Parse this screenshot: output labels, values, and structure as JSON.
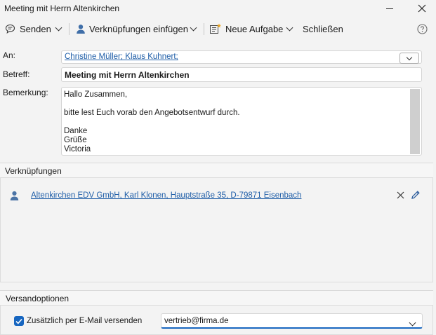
{
  "window": {
    "title": "Meeting mit Herrn Altenkirchen",
    "minimize_icon": "minimize-icon",
    "close_icon": "close-icon"
  },
  "toolbar": {
    "send_label": "Senden",
    "links_insert_label": "Verknüpfungen einfügen",
    "new_task_label": "Neue Aufgabe",
    "close_label": "Schließen",
    "help_icon": "help-icon"
  },
  "form": {
    "to_label": "An:",
    "to_value": "Christine Müller; Klaus Kuhnert;",
    "subject_label": "Betreff:",
    "subject_value": "Meeting mit Herrn Altenkirchen",
    "remark_label": "Bemerkung:",
    "remark_lines": [
      "Hallo Zusammen,",
      "",
      "bitte lest Euch vorab den Angebotsentwurf durch.",
      "",
      "Danke",
      "Grüße",
      "Victoria"
    ]
  },
  "links_section": {
    "header": "Verknüpfungen",
    "items": [
      {
        "text": "Altenkirchen EDV GmbH, Karl Klonen, Hauptstraße 35, D-79871 Eisenbach",
        "icon": "person-icon"
      }
    ]
  },
  "send_options": {
    "header": "Versandoptionen",
    "email_checkbox_label": "Zusätzlich per E-Mail versenden",
    "email_checkbox_checked": true,
    "email_value": "vertrieb@firma.de"
  },
  "colors": {
    "accent": "#1766c0",
    "link": "#1f5ea8",
    "background": "#f3f3f3"
  }
}
